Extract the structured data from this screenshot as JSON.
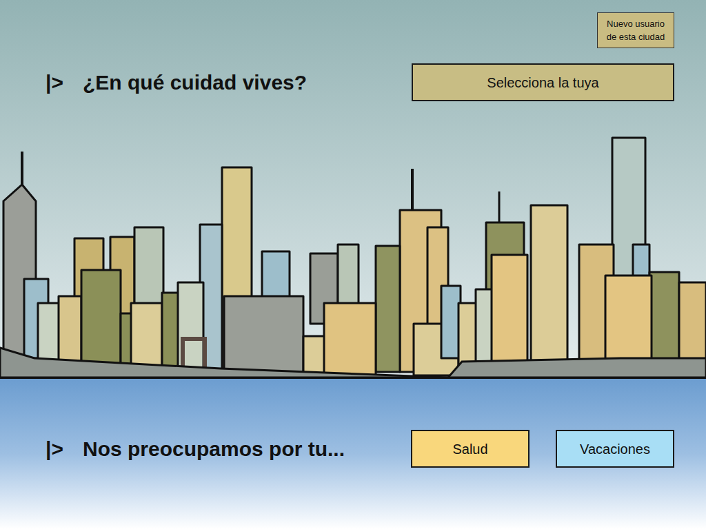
{
  "new_user_button": {
    "lines": [
      "Nuevo usuario",
      "de esta ciudad"
    ]
  },
  "sections": [
    {
      "marker": "|>",
      "prompt": "¿En qué cuidad vives?",
      "buttons": [
        {
          "label": "Selecciona la tuya",
          "color": "#c8bd84"
        }
      ]
    },
    {
      "marker": "|>",
      "prompt": "Nos preocupamos por tu...",
      "buttons": [
        {
          "label": "Salud",
          "color": "#f9d77c"
        },
        {
          "label": "Vacaciones",
          "color": "#a8def5"
        }
      ]
    }
  ]
}
